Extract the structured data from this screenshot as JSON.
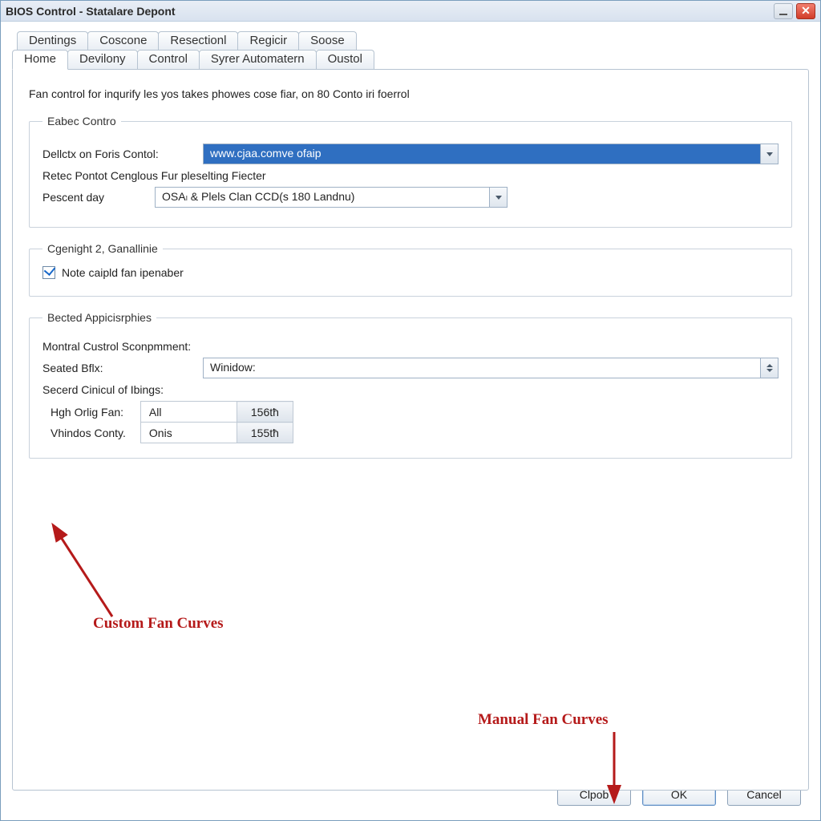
{
  "window": {
    "title": "BIOS Control - Statalare Depont"
  },
  "tabs_row1": [
    "Dentings",
    "Coscone",
    "Resectionl",
    "Regicir",
    "Soose"
  ],
  "tabs_row2": [
    "Home",
    "Devilony",
    "Control",
    "Syrer Automatern",
    "Oustol"
  ],
  "active_tab": "Home",
  "intro": "Fan control for inqurify les yos takes phowes cose fiar, on 80 Conto iri foerrol",
  "group_eabec": {
    "legend": "Eabec Contro",
    "row1_label": "Dellctx on Foris Contol:",
    "row1_value": "www.cjaa.comve ofaip",
    "row2_text": "Retec Pontot Cenglous Fur pleselting Fiecter",
    "row3_label": "Pescent day",
    "row3_value": "OSAₗ & Plels Clan CCD(s 180 Landnu)"
  },
  "group_cgenight": {
    "legend": "Cgenight 2, Ganallinie",
    "checkbox_label": "Note caipld fan ipenaber",
    "checked": true
  },
  "group_bected": {
    "legend": "Bected Appicisrphies",
    "line1": "Montral Custrol Sconpmment:",
    "row_seated_label": "Seated Bflx:",
    "row_seated_value": "Winidow:",
    "line2": "Secerd Cinicul of Ibings:",
    "table": [
      {
        "label": "Hgh Orlig Fan:",
        "value": "All",
        "btn": "156tħ"
      },
      {
        "label": "Vhindos Conty.",
        "value": "Onis",
        "btn": "155tħ"
      }
    ]
  },
  "annotations": {
    "custom": "Custom Fan Curves",
    "manual": "Manual Fan Curves"
  },
  "buttons": {
    "clpob": "Clpob",
    "ok": "OK",
    "cancel": "Cancel"
  }
}
